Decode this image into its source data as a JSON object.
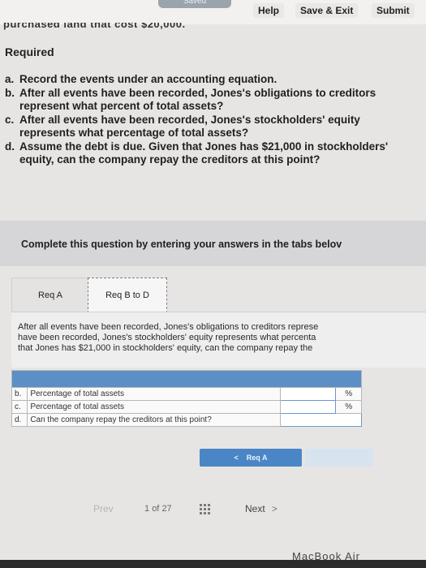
{
  "topbar": {
    "saved": "Saved",
    "help": "Help",
    "save_exit": "Save & Exit",
    "submit": "Submit"
  },
  "cut_text": "purchased land that cost $20,000.",
  "required_label": "Required",
  "questions": [
    {
      "letter": "a.",
      "text": "Record the events under an accounting equation."
    },
    {
      "letter": "b.",
      "text": "After all events have been recorded, Jones's obligations to creditors represent what percent of total assets?"
    },
    {
      "letter": "c.",
      "text": "After all events have been recorded, Jones's stockholders' equity represents what percentage of total assets?"
    },
    {
      "letter": "d.",
      "text": "Assume the debt is due. Given that Jones has $21,000 in stockholders' equity, can the company repay the creditors at this point?"
    }
  ],
  "banner": "Complete this question by entering your answers in the tabs belov",
  "tabs": [
    {
      "label": "Req A"
    },
    {
      "label": "Req B to D"
    }
  ],
  "panel_lines": [
    "After all events have been recorded, Jones's obligations to creditors represe",
    "have been recorded, Jones's stockholders' equity represents what percenta",
    "that Jones has $21,000 in stockholders' equity, can the company repay the"
  ],
  "answer_rows": [
    {
      "letter": "b.",
      "question": "Percentage of total assets",
      "value": "",
      "unit": "%"
    },
    {
      "letter": "c.",
      "question": "Percentage of total assets",
      "value": "",
      "unit": "%"
    },
    {
      "letter": "d.",
      "question": "Can the company repay the creditors at this point?",
      "value": "",
      "unit": ""
    }
  ],
  "nav_button": {
    "chevron": "<",
    "label": "Req A"
  },
  "footer": {
    "prev": "Prev",
    "page_current": "1",
    "page_of": "of",
    "page_total": "27",
    "next": "Next",
    "next_chevron": ">"
  },
  "bezel": "MacBook Air",
  "colors": {
    "accent": "#4a86c5",
    "table_header": "#5b8fc6"
  }
}
